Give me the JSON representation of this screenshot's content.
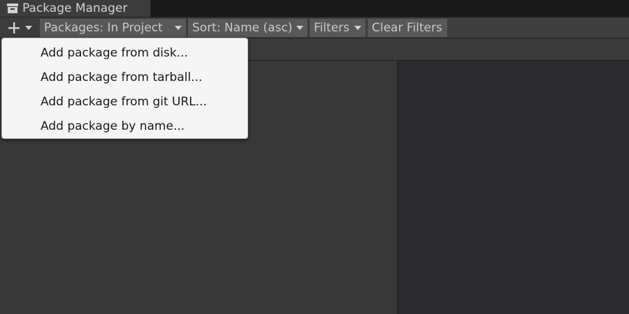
{
  "window": {
    "tab_title": "Package Manager",
    "tab_icon": "package-box-icon"
  },
  "toolbar": {
    "add_icon": "plus-icon",
    "packages_label": "Packages: In Project",
    "sort_label": "Sort: Name (asc)",
    "filters_label": "Filters",
    "clear_filters_label": "Clear Filters"
  },
  "add_menu": {
    "items": [
      {
        "label": "Add package from disk..."
      },
      {
        "label": "Add package from tarball..."
      },
      {
        "label": "Add package from git URL..."
      },
      {
        "label": "Add package by name..."
      }
    ]
  },
  "colors": {
    "editor_bg": "#383838",
    "toolbar_bg": "#3c3c3c",
    "button_bg": "#585858",
    "menu_bg": "#f5f5f5"
  }
}
